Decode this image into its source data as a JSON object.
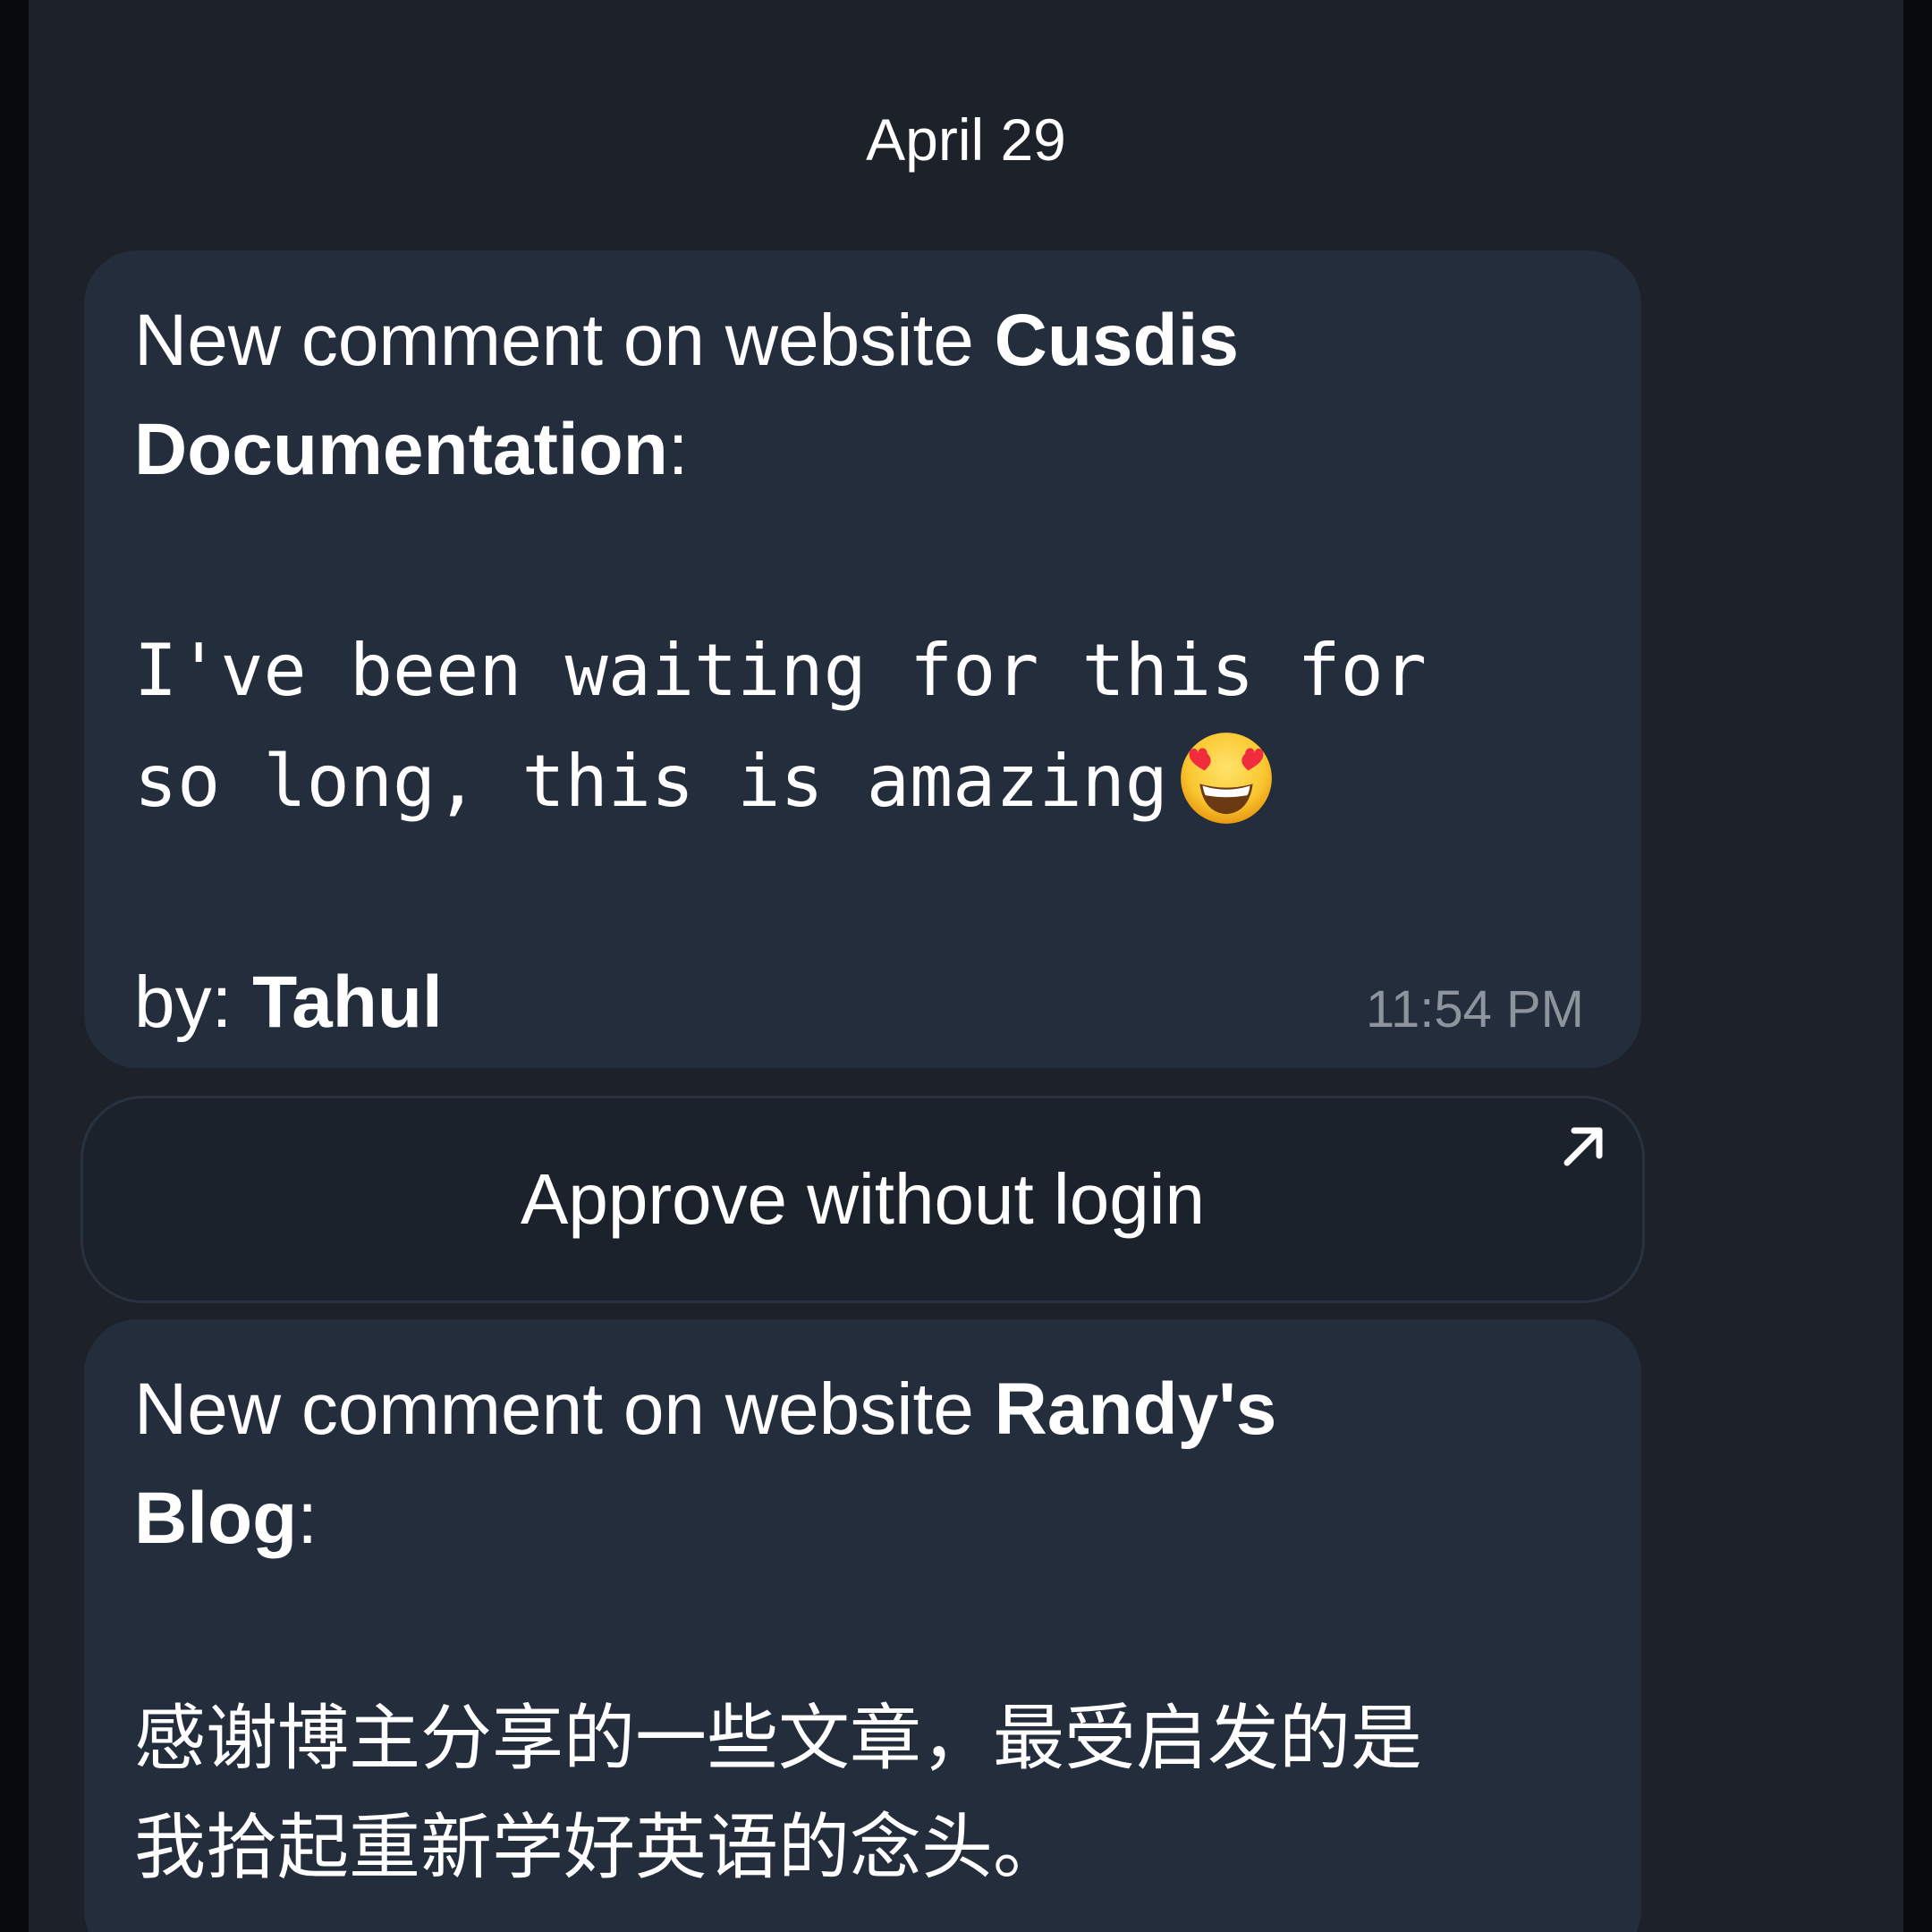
{
  "chat": {
    "date_header": "April 29",
    "messages": [
      {
        "prefix": "New comment on website ",
        "site_line1": "Cusdis",
        "site_line2": "Documentation",
        "suffix": ":",
        "body_line1": "I've been waiting for this for",
        "body_line2": "so long, this is amazing",
        "emoji": "smiling-face-with-heart-eyes",
        "by_label": "by: ",
        "author": "Tahul",
        "time": "11:54 PM"
      },
      {
        "prefix": "New comment on website ",
        "site_line1": "Randy's",
        "site_line2": "Blog",
        "suffix": ":",
        "body_line1": "感谢博主分享的一些文章，最受启发的是",
        "body_line2": "我拾起重新学好英语的念头。"
      }
    ],
    "inline_button": {
      "label": "Approve without login",
      "icon": "external-link-arrow-icon"
    }
  },
  "colors": {
    "background": "#1c212a",
    "bubble": "#232d3b",
    "text": "#ffffff",
    "timestamp": "#8d949e"
  }
}
